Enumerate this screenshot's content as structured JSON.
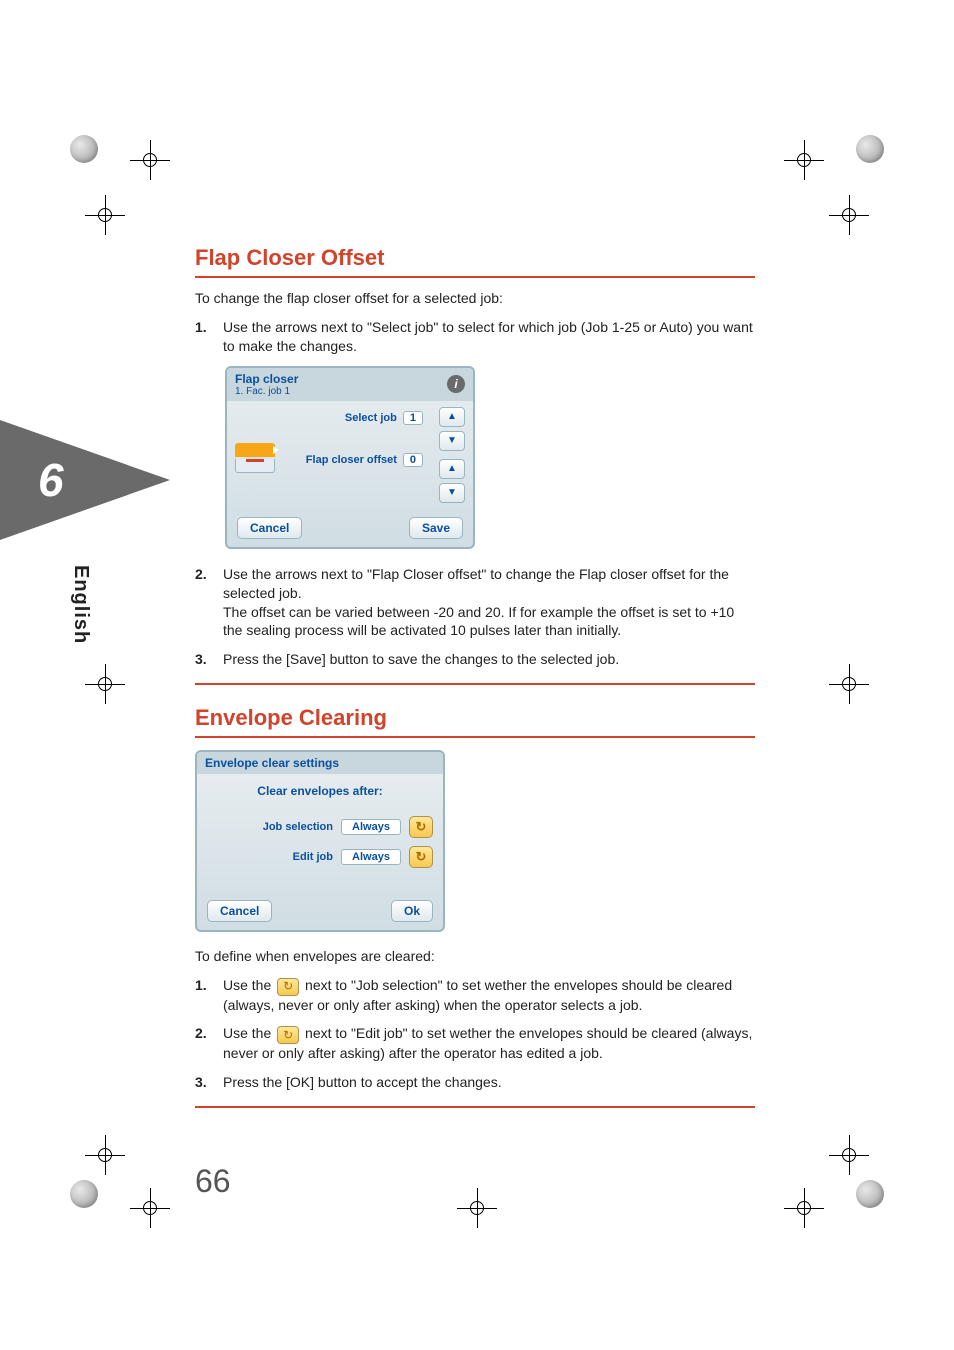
{
  "side": {
    "chapter": "6",
    "language": "English"
  },
  "section1": {
    "title": "Flap Closer Offset",
    "intro": "To change the flap closer offset for a selected job:",
    "steps": [
      "Use the arrows next to \"Select job\" to select for which job (Job 1-25 or Auto) you want to make the changes.",
      "Use the arrows next to \"Flap Closer offset\" to change the Flap closer offset for the selected job.",
      "Press the [Save] button to save the changes to the selected job."
    ],
    "step2_extra": "The offset can be varied between -20 and 20. If for example the offset is set to +10 the sealing process will be activated 10 pulses later than initially.",
    "panel": {
      "title": "Flap closer",
      "subtitle": "1. Fac. job 1",
      "select_label": "Select job",
      "select_value": "1",
      "offset_label": "Flap closer offset",
      "offset_value": "0",
      "cancel": "Cancel",
      "save": "Save"
    }
  },
  "section2": {
    "title": "Envelope Clearing",
    "panel": {
      "title": "Envelope clear settings",
      "header": "Clear envelopes after:",
      "row1_label": "Job selection",
      "row1_value": "Always",
      "row2_label": "Edit job",
      "row2_value": "Always",
      "cancel": "Cancel",
      "ok": "Ok"
    },
    "intro": "To define when envelopes are cleared:",
    "step1_a": "Use the ",
    "step1_b": " next to \"Job selection\" to set wether the envelopes should be cleared (always, never or only after asking) when the operator selects a job.",
    "step2_a": "Use the ",
    "step2_b": " next to \"Edit job\" to set wether the envelopes should be cleared (always, never or only after asking) after the operator has edited a job.",
    "step3": "Press the [OK] button to accept the changes."
  },
  "page_number": "66"
}
